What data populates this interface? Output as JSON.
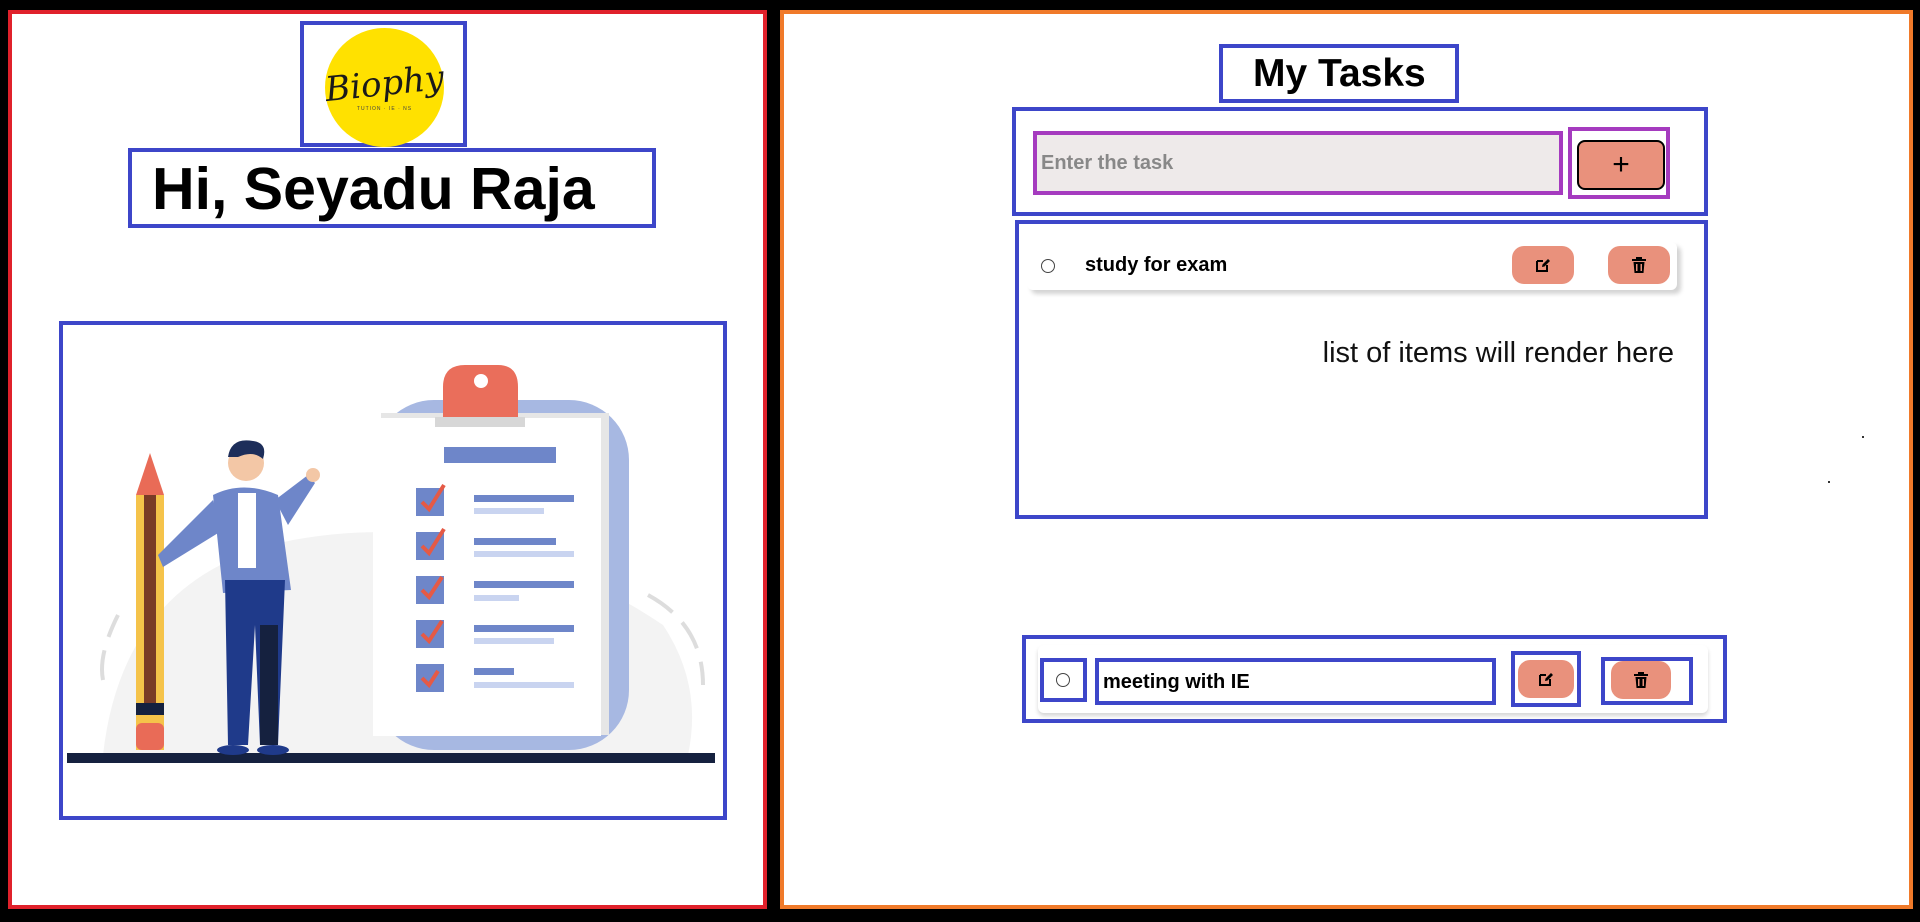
{
  "profile": {
    "logo_text": "Biophy",
    "logo_subtext": "TUTION · IE · NS",
    "greeting": "Hi, Seyadu Raja"
  },
  "tasks": {
    "title": "My Tasks",
    "input_placeholder": "Enter the task",
    "add_label": "+",
    "list_hint": "list of items will render here",
    "items": [
      {
        "label": "study for exam"
      },
      {
        "label": "meeting with IE"
      }
    ]
  },
  "colors": {
    "left_border": "#e0212b",
    "right_border": "#f07a2a",
    "annotation_border": "#3d46c9",
    "input_annotation_border": "#a53bbf",
    "button_accent": "#e9917c",
    "logo_bg": "#ffe100"
  },
  "icons": {
    "edit": "pen-square-icon",
    "delete": "trash-icon"
  }
}
